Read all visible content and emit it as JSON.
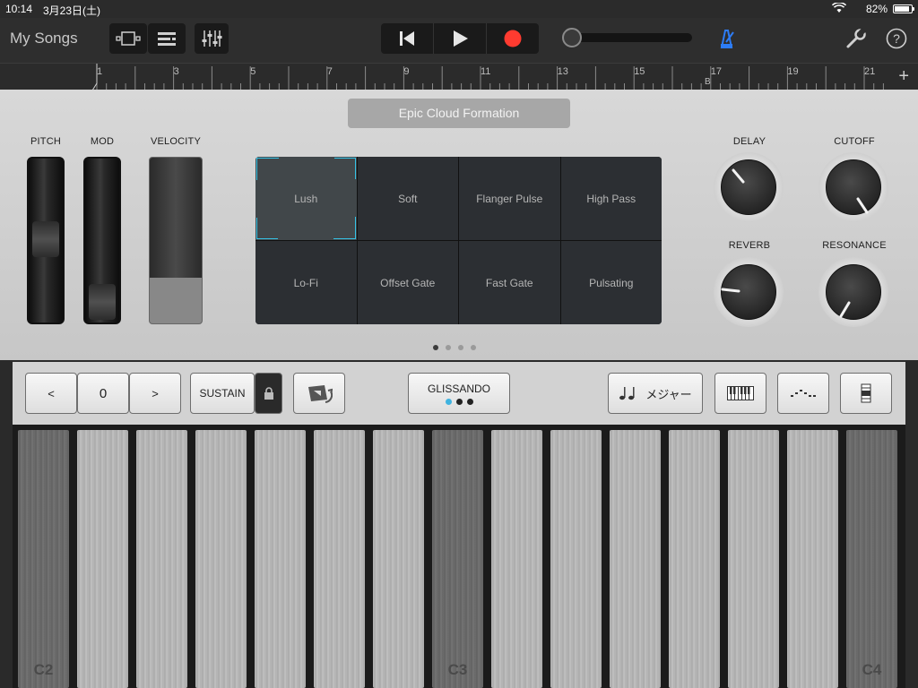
{
  "status_bar": {
    "time": "10:14",
    "date": "3月23日(土)",
    "battery": "82%"
  },
  "toolbar": {
    "my_songs": "My Songs",
    "buttons": [
      "tracks-view-icon",
      "track-list-icon",
      "mixer-icon"
    ],
    "transport": [
      "rewind-icon",
      "play-icon",
      "record-icon"
    ],
    "metronome_color": "#2d7cf6",
    "record_color": "#ff3b30"
  },
  "ruler": {
    "bars": [
      "1",
      "3",
      "5",
      "7",
      "9",
      "11",
      "13",
      "15",
      "17",
      "19",
      "21"
    ],
    "section_marker": "B"
  },
  "panel": {
    "patch_name": "Epic Cloud Formation",
    "labels": {
      "pitch": "PITCH",
      "mod": "MOD",
      "velocity": "VELOCITY"
    },
    "pads": [
      {
        "label": "Lush",
        "selected": true
      },
      {
        "label": "Soft"
      },
      {
        "label": "Flanger Pulse"
      },
      {
        "label": "High Pass"
      },
      {
        "label": "Lo-Fi"
      },
      {
        "label": "Offset Gate"
      },
      {
        "label": "Fast Gate"
      },
      {
        "label": "Pulsating"
      }
    ],
    "page_dots": {
      "count": 4,
      "active": 0
    },
    "knobs": {
      "delay": "DELAY",
      "cutoff": "CUTOFF",
      "reverb": "REVERB",
      "resonance": "RESONANCE"
    },
    "accent_color": "#35c3e6"
  },
  "controls": {
    "octave_prev": "<",
    "octave_value": "0",
    "octave_next": ">",
    "sustain": "SUSTAIN",
    "glissando": "GLISSANDO",
    "scale": "メジャー"
  },
  "keyboard": {
    "labels": {
      "c2": "C2",
      "c3": "C3",
      "c4": "C4"
    }
  }
}
